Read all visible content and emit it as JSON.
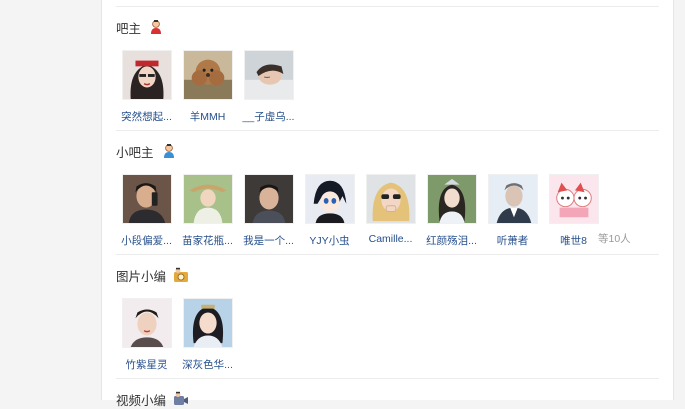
{
  "sections": [
    {
      "title": "吧主",
      "icon": "owner-badge-icon",
      "members": [
        {
          "name": "突然想起..."
        },
        {
          "name": "羊MMH"
        },
        {
          "name": "__子虚乌..."
        }
      ]
    },
    {
      "title": "小吧主",
      "icon": "sub-owner-badge-icon",
      "members": [
        {
          "name": "小段偏爱..."
        },
        {
          "name": "苗家花瓶..."
        },
        {
          "name": "我是一个..."
        },
        {
          "name": "YJY小虫"
        },
        {
          "name": "Camille..."
        },
        {
          "name": "红颜殇泪..."
        },
        {
          "name": "听萧者"
        },
        {
          "name": "唯世8"
        }
      ],
      "more": "等10人"
    },
    {
      "title": "图片小编",
      "icon": "photo-editor-badge-icon",
      "members": [
        {
          "name": "竹紫星灵"
        },
        {
          "name": "深灰色华..."
        }
      ]
    },
    {
      "title": "视频小编",
      "icon": "video-editor-badge-icon",
      "members": []
    }
  ]
}
